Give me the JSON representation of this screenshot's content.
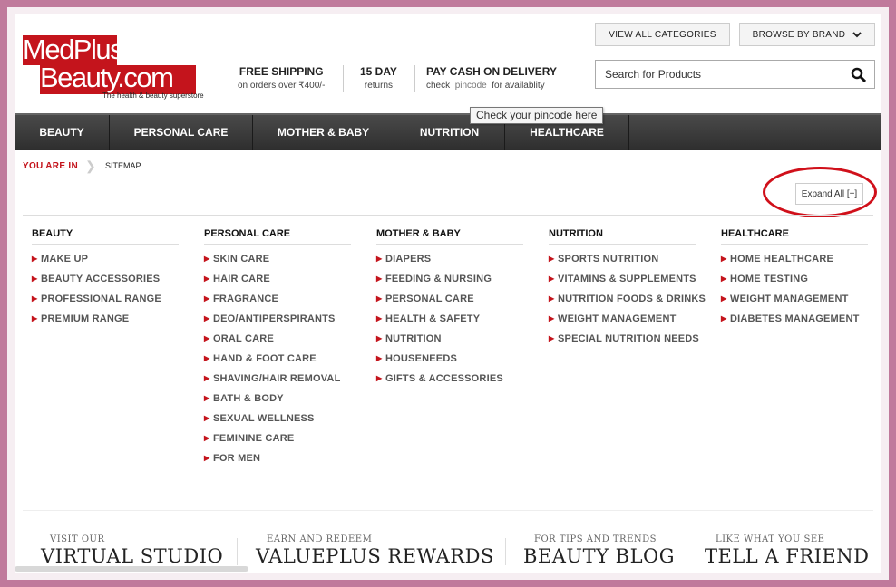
{
  "logo": {
    "line1": "MedPlus",
    "line2": "Beauty.com",
    "tagline": "The health & beauty superstore"
  },
  "usps": [
    {
      "title": "FREE SHIPPING",
      "sub": "on orders over ₹400/-"
    },
    {
      "title": "15 DAY",
      "sub": "returns"
    },
    {
      "title": "PAY CASH ON DELIVERY",
      "sub_pre": "check",
      "sub_pin": "pincode",
      "sub_post": "for availablity"
    }
  ],
  "header": {
    "view_all": "VIEW ALL CATEGORIES",
    "browse_brand": "BROWSE BY BRAND",
    "search_placeholder": "Search for Products",
    "tooltip": "Check your pincode here"
  },
  "nav": [
    "BEAUTY",
    "PERSONAL CARE",
    "MOTHER & BABY",
    "NUTRITION",
    "HEALTHCARE"
  ],
  "breadcrumb": {
    "you_are_in": "YOU ARE IN",
    "current": "SITEMAP"
  },
  "expand_all": "Expand All [+]",
  "sitemap": [
    {
      "title": "BEAUTY",
      "items": [
        "MAKE UP",
        "BEAUTY ACCESSORIES",
        "PROFESSIONAL RANGE",
        "PREMIUM RANGE"
      ]
    },
    {
      "title": "PERSONAL CARE",
      "items": [
        "SKIN CARE",
        "HAIR CARE",
        "FRAGRANCE",
        "DEO/ANTIPERSPIRANTS",
        "ORAL CARE",
        "HAND & FOOT CARE",
        "SHAVING/HAIR REMOVAL",
        "BATH & BODY",
        "SEXUAL WELLNESS",
        "FEMININE CARE",
        "FOR MEN"
      ]
    },
    {
      "title": "MOTHER & BABY",
      "items": [
        "DIAPERS",
        "FEEDING & NURSING",
        "PERSONAL CARE",
        "HEALTH & SAFETY",
        "NUTRITION",
        "HOUSENEEDS",
        "GIFTS & ACCESSORIES"
      ]
    },
    {
      "title": "NUTRITION",
      "items": [
        "SPORTS NUTRITION",
        "VITAMINS & SUPPLEMENTS",
        "NUTRITION FOODS & DRINKS",
        "WEIGHT MANAGEMENT",
        "SPECIAL NUTRITION NEEDS"
      ]
    },
    {
      "title": "HEALTHCARE",
      "items": [
        "HOME HEALTHCARE",
        "HOME TESTING",
        "WEIGHT MANAGEMENT",
        "DIABETES MANAGEMENT"
      ]
    }
  ],
  "promos": [
    {
      "small": "VISIT OUR",
      "big": "VIRTUAL STUDIO"
    },
    {
      "small": "EARN AND REDEEM",
      "big": "VALUEPLUS REWARDS"
    },
    {
      "small": "FOR TIPS  AND TRENDS",
      "big": "BEAUTY BLOG"
    },
    {
      "small": "LIKE WHAT YOU SEE",
      "big": "TELL A FRIEND"
    }
  ],
  "colors": {
    "brand_red": "#c4141c",
    "frame": "#c07a9c",
    "nav_bg": "#3a3a3a",
    "annotation": "#d0101a"
  },
  "icons": {
    "search": "search-icon",
    "chevron": "chevron-down-icon",
    "bullet": "triangle-right-icon"
  }
}
